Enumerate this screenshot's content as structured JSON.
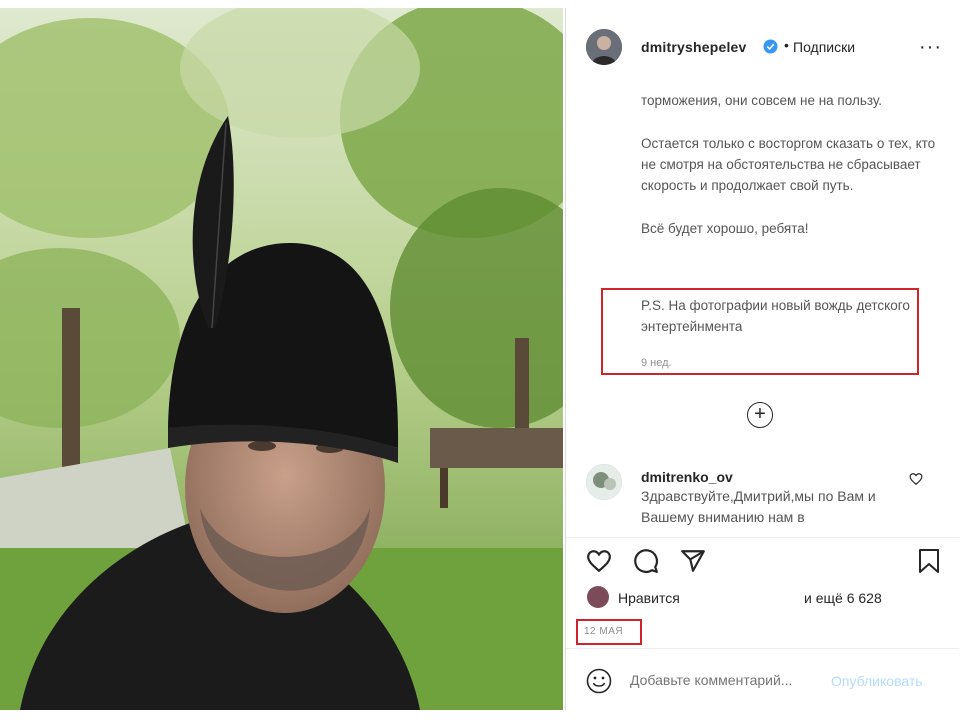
{
  "post": {
    "photo_description_icon": "photo",
    "header": {
      "username": "dmitryshepelev",
      "verified_icon": "verified-badge-icon",
      "separator": "•",
      "follow_label": "Подписки",
      "more_icon": "more-options-icon",
      "more_glyph": "···"
    },
    "caption": {
      "paragraphs": [
        "торможения, они совсем не на пользу.",
        "Остается только с восторгом сказать о тех, кто не смотря на обстоятельства не сбрасывает скорость и продолжает свой путь.",
        "Всё будет хорошо, ребята!"
      ],
      "ps": "P.S. На фотографии новый вождь детского энтертейнмента",
      "age": "9 нед."
    },
    "load_more_glyph": "+",
    "comment": {
      "username": "dmitrenko_ov",
      "text": "Здравствуйте,Дмитрий,мы по Вам и Вашему вниманию нам в"
    },
    "actions": {
      "like_icon": "heart-icon",
      "comment_icon": "comment-icon",
      "share_icon": "share-icon",
      "save_icon": "bookmark-icon"
    },
    "likes": {
      "label": "Нравится",
      "more": "и ещё 6 628"
    },
    "date": "12 МАЯ",
    "add_comment": {
      "placeholder": "Добавьте комментарий...",
      "publish_label": "Опубликовать"
    },
    "colors": {
      "highlight": "#d0242b",
      "verified": "#3897f0",
      "publish": "#b3dbff"
    }
  }
}
